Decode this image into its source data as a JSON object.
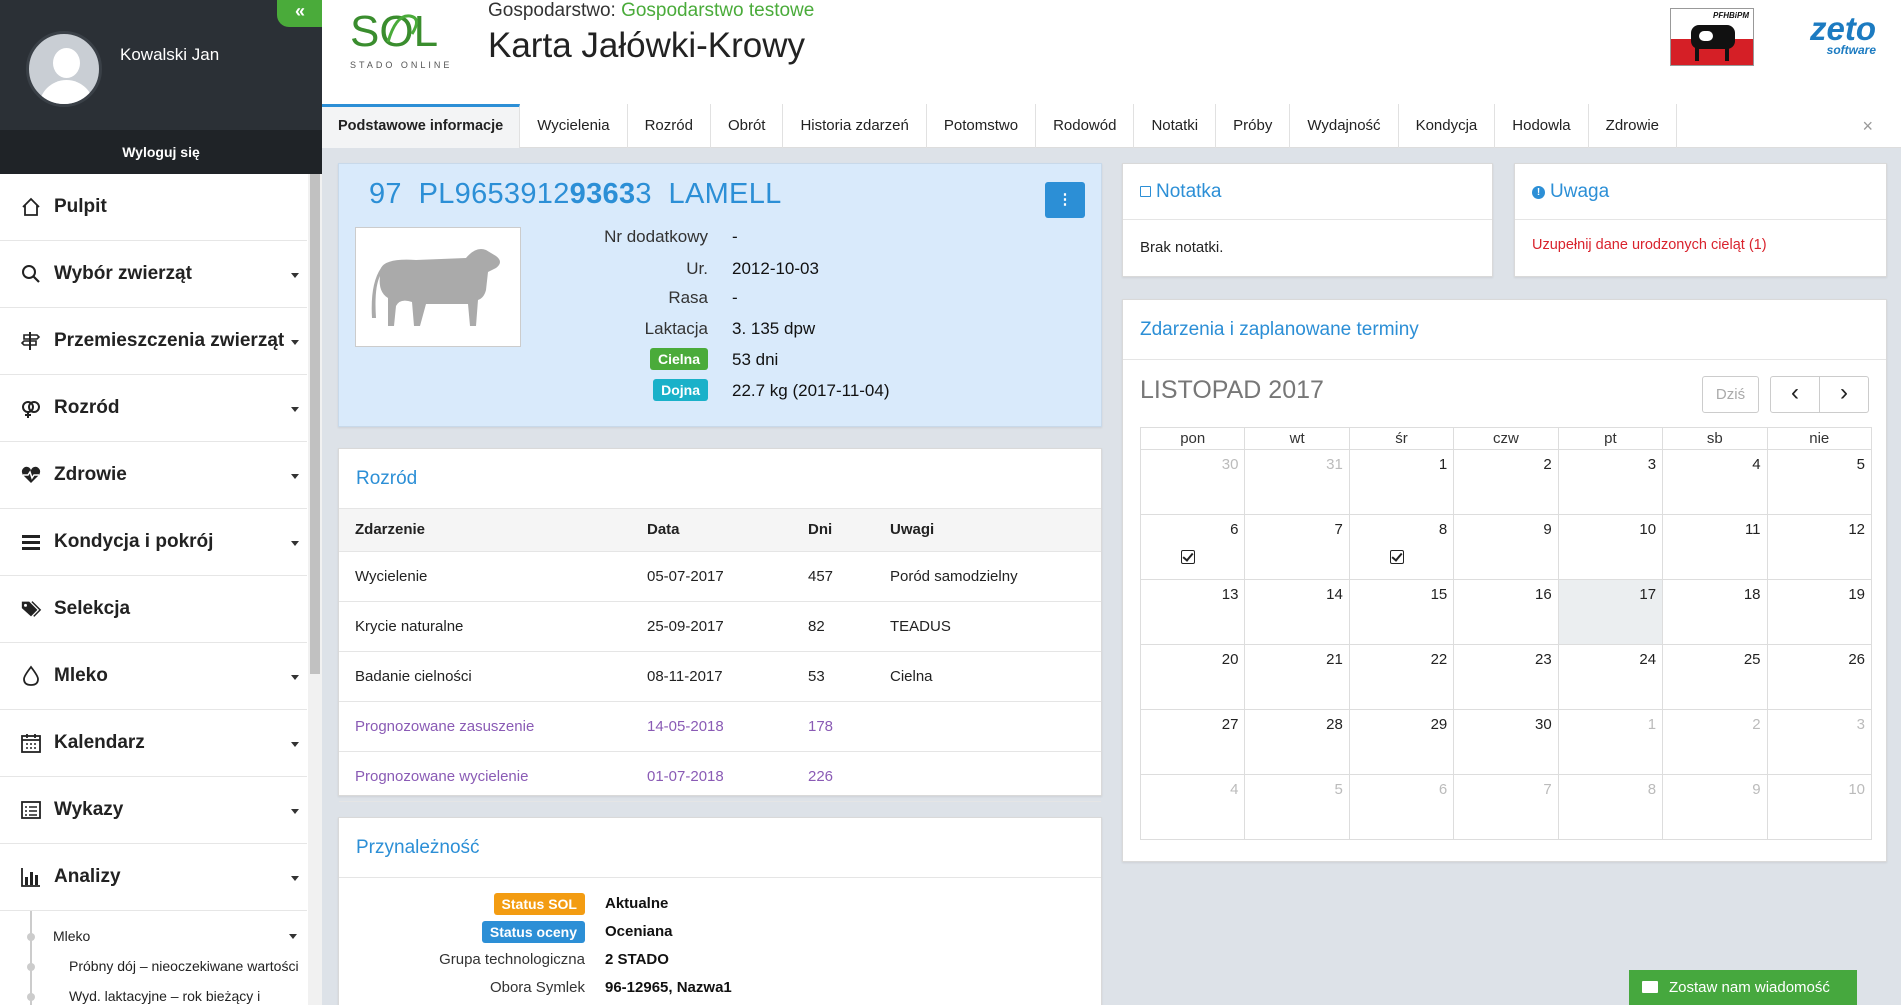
{
  "user": {
    "name": "Kowalski Jan",
    "logout": "Wyloguj się",
    "collapse_icon": "«"
  },
  "nav": [
    {
      "label": "Pulpit",
      "icon": "home-icon",
      "caret": false
    },
    {
      "label": "Wybór zwierząt",
      "icon": "search-icon",
      "caret": true
    },
    {
      "label": "Przemieszczenia zwierząt",
      "icon": "signpost-icon",
      "caret": true
    },
    {
      "label": "Rozród",
      "icon": "gender-icon",
      "caret": true
    },
    {
      "label": "Zdrowie",
      "icon": "heartbeat-icon",
      "caret": true
    },
    {
      "label": "Kondycja i pokrój",
      "icon": "list-icon",
      "caret": true
    },
    {
      "label": "Selekcja",
      "icon": "tags-icon",
      "caret": false
    },
    {
      "label": "Mleko",
      "icon": "drop-icon",
      "caret": true
    },
    {
      "label": "Kalendarz",
      "icon": "calendar-icon",
      "caret": true
    },
    {
      "label": "Wykazy",
      "icon": "list-alt-icon",
      "caret": true
    },
    {
      "label": "Analizy",
      "icon": "chart-icon",
      "caret": true
    }
  ],
  "subnav": {
    "mleko": "Mleko",
    "item1": "Próbny dój – nieoczekiwane wartości",
    "item2": "Wyd. laktacyjne – rok bieżący i"
  },
  "header": {
    "logo_text": "SOL",
    "logo_sub": "STADO ONLINE",
    "farm_label": "Gospodarstwo:",
    "farm_name": "Gospodarstwo testowe",
    "title": "Karta Jałówki-Krowy",
    "pfhb": "PFHBiPM",
    "zeto": "zeto",
    "zeto_sub": "software"
  },
  "tabs": [
    "Podstawowe informacje",
    "Wycielenia",
    "Rozród",
    "Obrót",
    "Historia zdarzeń",
    "Potomstwo",
    "Rodowód",
    "Notatki",
    "Próby",
    "Wydajność",
    "Kondycja",
    "Hodowla",
    "Zdrowie"
  ],
  "tab_close": "×",
  "animal": {
    "num": "97",
    "id_prefix": "PL9653912",
    "id_bold": "9363",
    "id_suffix": "3",
    "name": "LAMELL",
    "more": "⋮",
    "labels": [
      "Nr dodatkowy",
      "Ur.",
      "Rasa",
      "Laktacja"
    ],
    "values": [
      "-",
      "2012-10-03",
      "-",
      "3. 135 dpw"
    ],
    "badge1": "Cielna",
    "badge1_val": "53 dni",
    "badge2": "Dojna",
    "badge2_val": "22.7 kg (2017-11-04)"
  },
  "rozrod": {
    "title": "Rozród",
    "headers": [
      "Zdarzenie",
      "Data",
      "Dni",
      "Uwagi"
    ],
    "rows": [
      [
        "Wycielenie",
        "05-07-2017",
        "457",
        "Poród samodzielny"
      ],
      [
        "Krycie naturalne",
        "25-09-2017",
        "82",
        "TEADUS"
      ],
      [
        "Badanie cielności",
        "08-11-2017",
        "53",
        "Cielna"
      ],
      [
        "Prognozowane zasuszenie",
        "14-05-2018",
        "178",
        ""
      ],
      [
        "Prognozowane wycielenie",
        "01-07-2018",
        "226",
        ""
      ]
    ]
  },
  "przynaleznosc": {
    "title": "Przynależność",
    "status_sol": "Status SOL",
    "status_sol_val": "Aktualne",
    "status_oceny": "Status oceny",
    "status_oceny_val": "Oceniana",
    "grupa": "Grupa technologiczna",
    "grupa_val": "2 STADO",
    "obora": "Obora Symlek",
    "obora_val": "96-12965, Nazwa1"
  },
  "note": {
    "title": "Notatka",
    "text": "Brak notatki."
  },
  "warning": {
    "title": "Uwaga",
    "text": "Uzupełnij dane urodzonych cieląt (1)"
  },
  "calendar": {
    "title": "Zdarzenia i zaplanowane terminy",
    "month": "LISTOPAD 2017",
    "today_btn": "Dziś",
    "prev": "‹",
    "next": "›",
    "days": [
      "pon",
      "wt",
      "śr",
      "czw",
      "pt",
      "sb",
      "nie"
    ],
    "weeks": [
      [
        "30",
        "31",
        "1",
        "2",
        "3",
        "4",
        "5"
      ],
      [
        "6",
        "7",
        "8",
        "9",
        "10",
        "11",
        "12"
      ],
      [
        "13",
        "14",
        "15",
        "16",
        "17",
        "18",
        "19"
      ],
      [
        "20",
        "21",
        "22",
        "23",
        "24",
        "25",
        "26"
      ],
      [
        "27",
        "28",
        "29",
        "30",
        "1",
        "2",
        "3"
      ],
      [
        "4",
        "5",
        "6",
        "7",
        "8",
        "9",
        "10"
      ]
    ]
  },
  "feedback": "Zostaw nam wiadomość",
  "colors": {
    "accent": "#2c8fd6",
    "green": "#4aab3a",
    "predicted": "#8a5bb5",
    "warning": "#d9232d"
  }
}
